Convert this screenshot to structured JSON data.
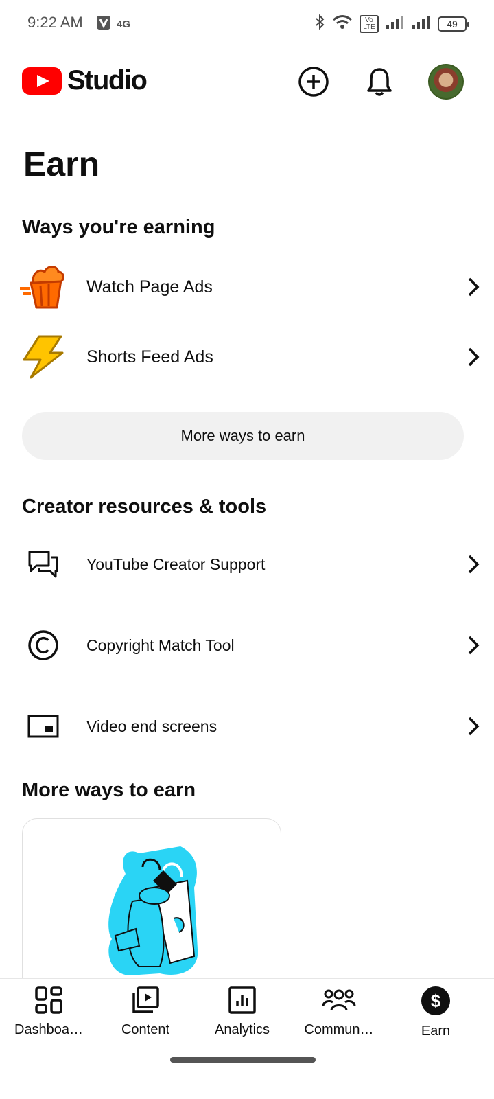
{
  "status_bar": {
    "time": "9:22 AM",
    "network": "4G",
    "volte": "Vo LTE",
    "battery": "49"
  },
  "app": {
    "name": "Studio"
  },
  "page": {
    "title": "Earn"
  },
  "earning": {
    "title": "Ways you're earning",
    "items": [
      {
        "label": "Watch Page Ads",
        "icon": "popcorn-icon"
      },
      {
        "label": "Shorts Feed Ads",
        "icon": "lightning-icon"
      }
    ],
    "more_button": "More ways to earn"
  },
  "resources": {
    "title": "Creator resources & tools",
    "items": [
      {
        "label": "YouTube Creator Support",
        "icon": "chat-bubbles-icon"
      },
      {
        "label": "Copyright Match Tool",
        "icon": "copyright-icon"
      },
      {
        "label": "Video end screens",
        "icon": "end-screen-icon"
      }
    ]
  },
  "more_ways": {
    "title": "More ways to earn"
  },
  "bottom_nav": {
    "items": [
      {
        "label": "Dashboa…",
        "icon": "dashboard-icon"
      },
      {
        "label": "Content",
        "icon": "content-icon"
      },
      {
        "label": "Analytics",
        "icon": "analytics-icon"
      },
      {
        "label": "Commun…",
        "icon": "community-icon"
      },
      {
        "label": "Earn",
        "icon": "dollar-icon",
        "active": true
      }
    ]
  },
  "colors": {
    "brand_red": "#ff0000",
    "text": "#0f0f0f",
    "pill_bg": "#f1f1f1",
    "shorts_cyan": "#2ad4f5"
  }
}
